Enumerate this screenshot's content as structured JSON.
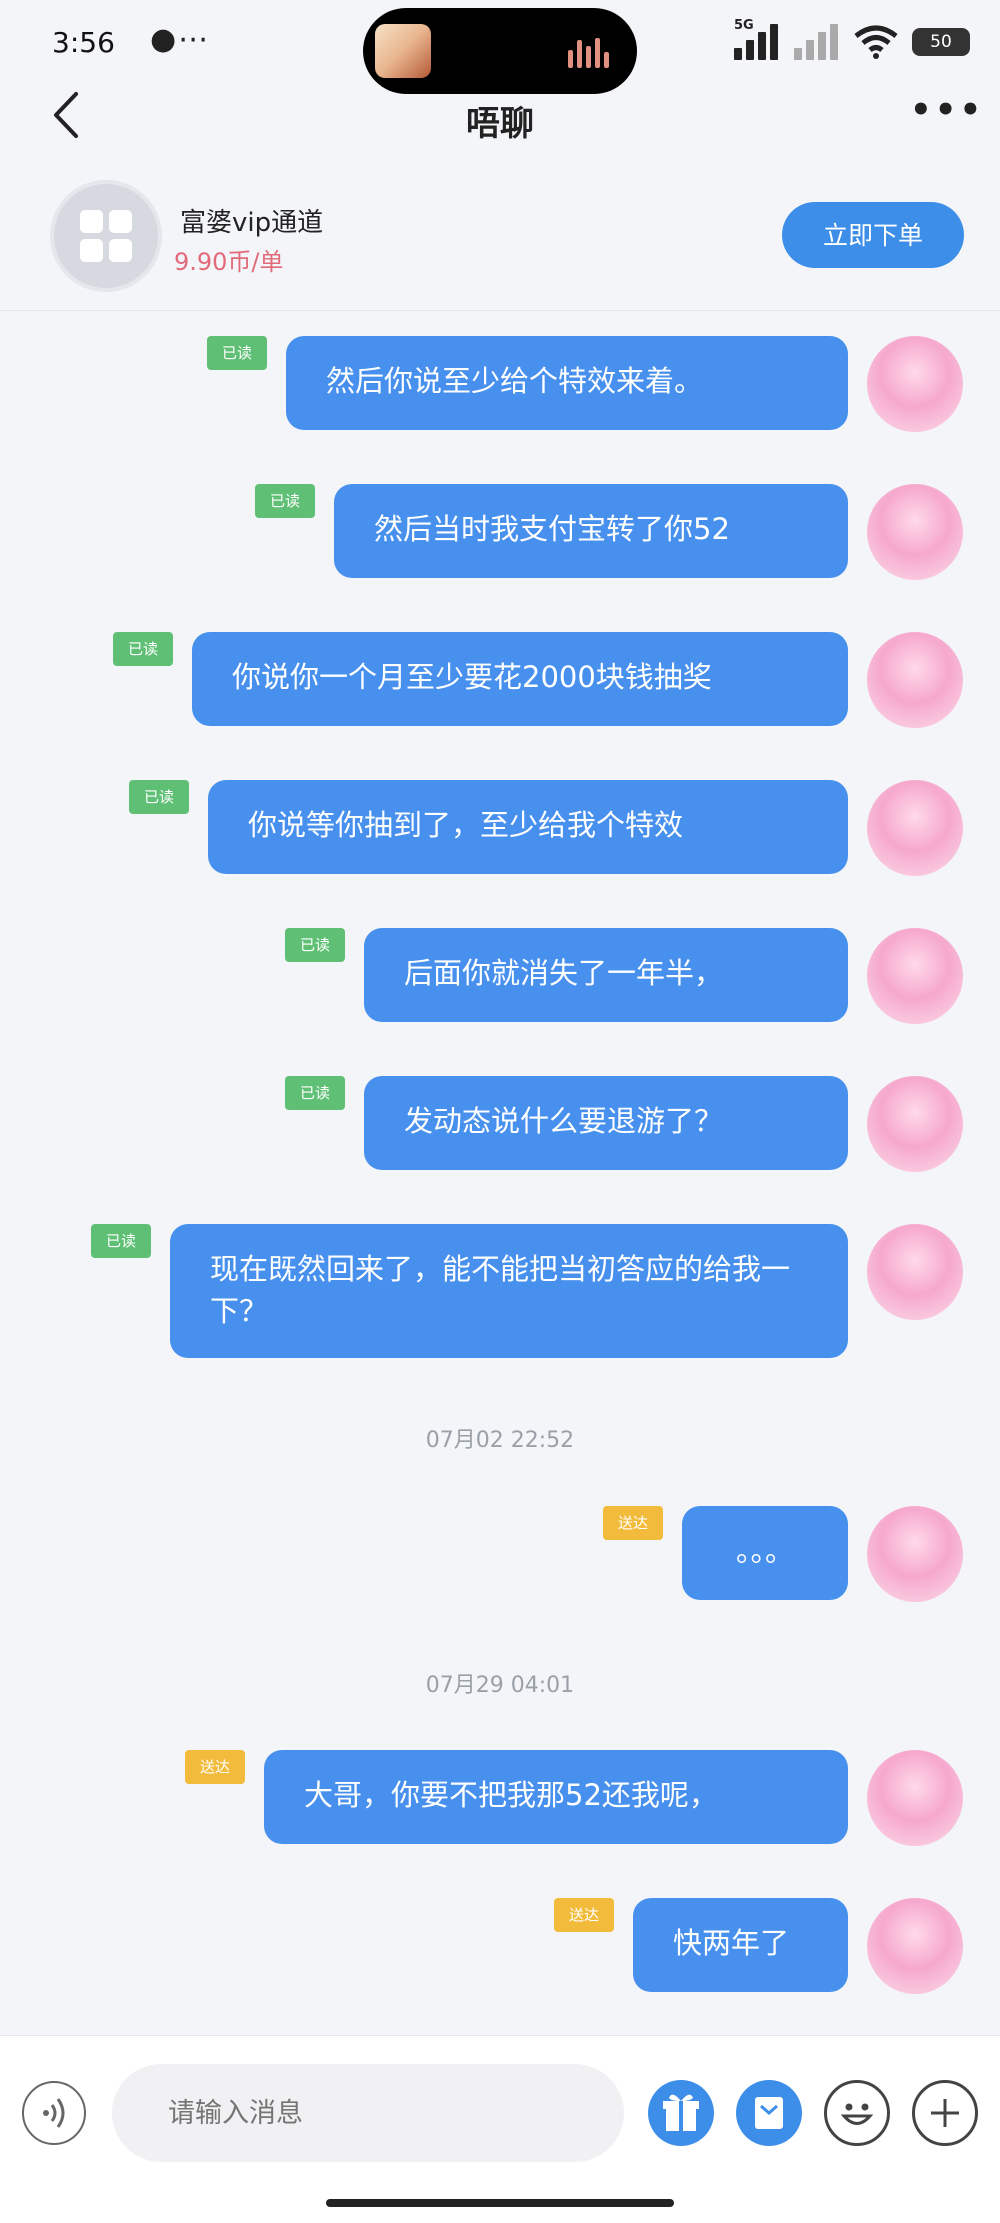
{
  "status_bar": {
    "time": "3:56",
    "network": "5G",
    "battery": "50"
  },
  "header": {
    "title": "唔聊",
    "back_icon": "chevron-left-icon",
    "more_icon": "more-dots-icon"
  },
  "service": {
    "name": "富婆vip通道",
    "price": "9.90币/单",
    "order_label": "立即下单"
  },
  "messages": [
    {
      "status": "已读",
      "text": "然后你说至少给个特效来着。"
    },
    {
      "status": "已读",
      "text": "然后当时我支付宝转了你52"
    },
    {
      "status": "已读",
      "text": "你说你一个月至少要花2000块钱抽奖"
    },
    {
      "status": "已读",
      "text": "你说等你抽到了，至少给我个特效"
    },
    {
      "status": "已读",
      "text": "后面你就消失了一年半，"
    },
    {
      "status": "已读",
      "text": "发动态说什么要退游了？"
    },
    {
      "status": "已读",
      "text": "现在既然回来了，能不能把当初答应的给我一下？"
    },
    {
      "status": "送达",
      "text": "。。。"
    },
    {
      "status": "送达",
      "text": "大哥，你要不把我那52还我呢，"
    },
    {
      "status": "送达",
      "text": "快两年了"
    }
  ],
  "timestamps": [
    "07月02 22:52",
    "07月29 04:01"
  ],
  "input": {
    "placeholder": "请输入消息"
  },
  "icons": {
    "voice": "voice-icon",
    "gift": "gift-icon",
    "card": "card-icon",
    "emoji": "emoji-icon",
    "plus": "plus-icon"
  },
  "colors": {
    "bubble": "#4790ee",
    "read_badge": "#5fc075",
    "sent_badge": "#f2bb3b",
    "price": "#e16b7a",
    "accent": "#3d8ee8"
  }
}
